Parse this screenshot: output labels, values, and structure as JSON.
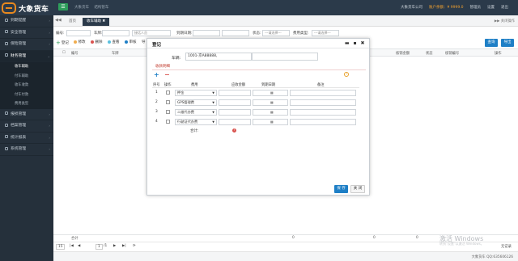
{
  "app": {
    "logo_text": "大象货车",
    "menu_button": "☰",
    "top_links": [
      "大象货车",
      "结构管车"
    ],
    "right": {
      "user": "大象货车公司",
      "balance_label": "账户余额：¥ 9999.0",
      "menu": "管理员",
      "settings": "设置",
      "logout": "退出"
    }
  },
  "sidebar": {
    "items": [
      {
        "label": "到期提醒"
      },
      {
        "label": "安全管理"
      },
      {
        "label": "保险管理"
      },
      {
        "label": "财务管理",
        "open": true
      },
      {
        "label": "报损管理"
      },
      {
        "label": "档案管理"
      },
      {
        "label": "统计报表"
      },
      {
        "label": "系统管理"
      }
    ],
    "sub_items": [
      "收车辅助",
      "付车辅助",
      "收车收款",
      "付车付款",
      "费用类型"
    ]
  },
  "tabs": {
    "nav": "◀◀",
    "items": [
      "首页",
      "收车辅助 ✖"
    ],
    "right": "▶▶  关闭操作"
  },
  "filters": {
    "car_label": "编号:",
    "car_no_label": "车牌:",
    "person_placeholder": "接话人员",
    "date_label": "到期日期:",
    "status_label": "状态:",
    "status_value": "---请选择---",
    "fee_label": "费用类型:",
    "fee_value": "---请选择---"
  },
  "toolbar": {
    "add": "登记",
    "edit": "修改",
    "delete": "删除",
    "check": "查看",
    "audit": "审核",
    "more": "导",
    "search_btn": "查询",
    "export_btn": "导出"
  },
  "grid": {
    "headers": [
      "编号",
      "车牌",
      "核销金额",
      "状态",
      "核销编号",
      "操作"
    ],
    "footer": [
      "合计",
      "0",
      "0",
      "0"
    ]
  },
  "pager": {
    "size": "15",
    "page": "1",
    "of": "/1",
    "right": "无记录"
  },
  "watermark": {
    "line1": "激活 Windows",
    "line2": "转到\"设置\"以激活 Windows。"
  },
  "status": "大象货车 QQ:635606126",
  "modal": {
    "title": "登记",
    "controls": "▬ ▪ ✖",
    "car_label": "车辆:",
    "car_value": "1001-京A88888,",
    "section": "收款明细",
    "help": "?",
    "headers": [
      "序号",
      "操作",
      "费用",
      "应收金额",
      "到期日期",
      "备注"
    ],
    "rows": [
      {
        "no": "1",
        "fee": "押金"
      },
      {
        "no": "2",
        "fee": "GPS管理费"
      },
      {
        "no": "3",
        "fee": "二维代办费"
      },
      {
        "no": "4",
        "fee": "行驶证代办费"
      }
    ],
    "calendar_icon": "▦",
    "total_label": "合计:",
    "ok": "保 存",
    "close": "关 闭"
  }
}
